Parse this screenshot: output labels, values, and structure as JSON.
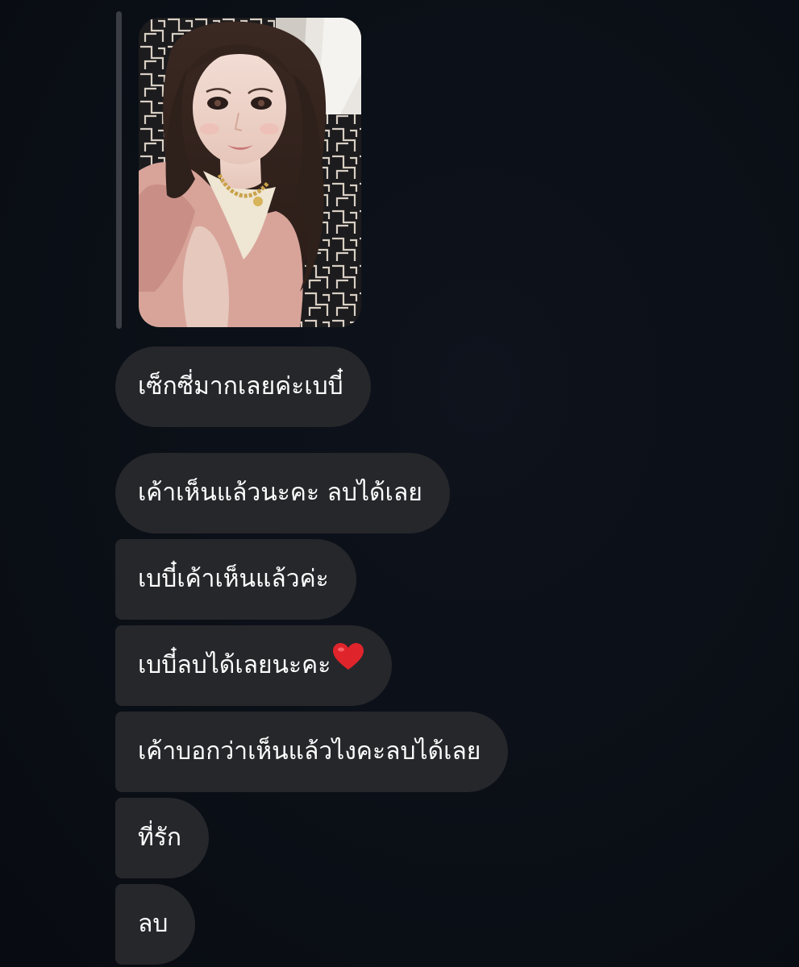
{
  "messages": [
    {
      "text": "เซ็กซี่มากเลยค่ะเบบี๋"
    },
    {
      "text": "เค้าเห็นแล้วนะคะ ลบได้เลย"
    },
    {
      "text": "เบบี๋เค้าเห็นแล้วค่ะ"
    },
    {
      "text": "เบบี๋ลบได้เลยนะคะ",
      "emoji": "red-heart-icon"
    },
    {
      "text": "เค้าบอกว่าเห็นแล้วไงคะลบได้เลย"
    },
    {
      "text": "ที่รัก"
    },
    {
      "text": "ลบ"
    }
  ],
  "colors": {
    "background": "#0b0f17",
    "bubble": "#26272b",
    "reply_bar": "#3a3d44",
    "text": "#ffffff",
    "heart": "#e0242b"
  }
}
